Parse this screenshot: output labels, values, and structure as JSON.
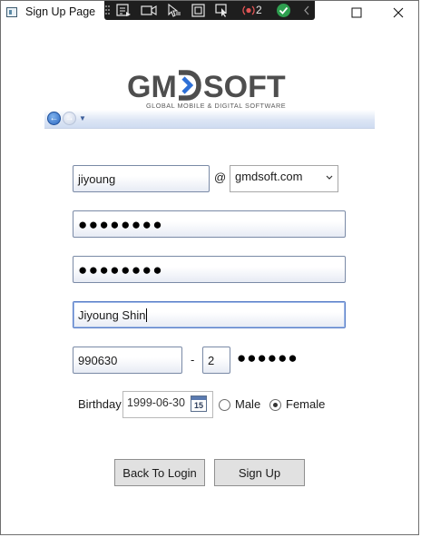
{
  "window": {
    "title": "Sign Up Page",
    "debug_toolbar": {
      "badge_count": "2"
    }
  },
  "brand": {
    "logo_text": "GMDSOFT",
    "tagline": "GLOBAL MOBILE & DIGITAL SOFTWARE",
    "colors": {
      "logo_gray": "#4e4e4e",
      "logo_accent": "#2d6fd6"
    }
  },
  "navigation": {
    "back_icon": "back-arrow-icon",
    "forward_icon": "forward-arrow-icon",
    "menu_icon": "dropdown-arrow-icon"
  },
  "form": {
    "email_id": "jiyoung",
    "at_symbol": "@",
    "email_domain": {
      "selected": "gmdsoft.com"
    },
    "password_mask": "●●●●●●●●",
    "confirm_password_mask": "●●●●●●●●",
    "name": "Jiyoung Shin",
    "resident_front": "990630",
    "resident_dash": "-",
    "resident_back_first": "2",
    "resident_back_mask": "●●●●●●",
    "birthday_label": "Birthday",
    "birthday_value": "1999-06-30",
    "calendar_day": "15",
    "gender": {
      "options": [
        "Male",
        "Female"
      ],
      "selected": "Female"
    }
  },
  "buttons": {
    "back_to_login": "Back To Login",
    "sign_up": "Sign Up"
  }
}
